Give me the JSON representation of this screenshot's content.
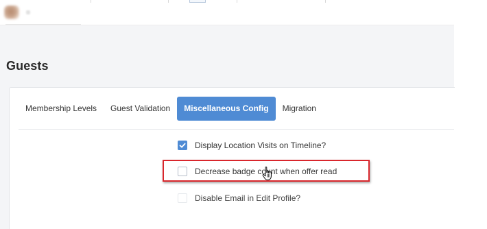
{
  "page": {
    "title": "Guests"
  },
  "tabs": [
    {
      "label": "Membership Levels",
      "active": false
    },
    {
      "label": "Guest Validation",
      "active": false
    },
    {
      "label": "Miscellaneous Config",
      "active": true
    },
    {
      "label": "Migration",
      "active": false
    }
  ],
  "options": [
    {
      "label": "Display Location Visits on Timeline?",
      "checked": true
    },
    {
      "label": "Decrease badge count when offer read",
      "checked": false
    },
    {
      "label": "Disable Email in Edit Profile?",
      "checked": false
    }
  ],
  "colors": {
    "accent": "#4f8bd4",
    "highlight": "#d9262c",
    "content_background": "#f4f5f7"
  },
  "icons": {
    "check": "check-icon",
    "cursor": "hand-pointer-icon"
  }
}
